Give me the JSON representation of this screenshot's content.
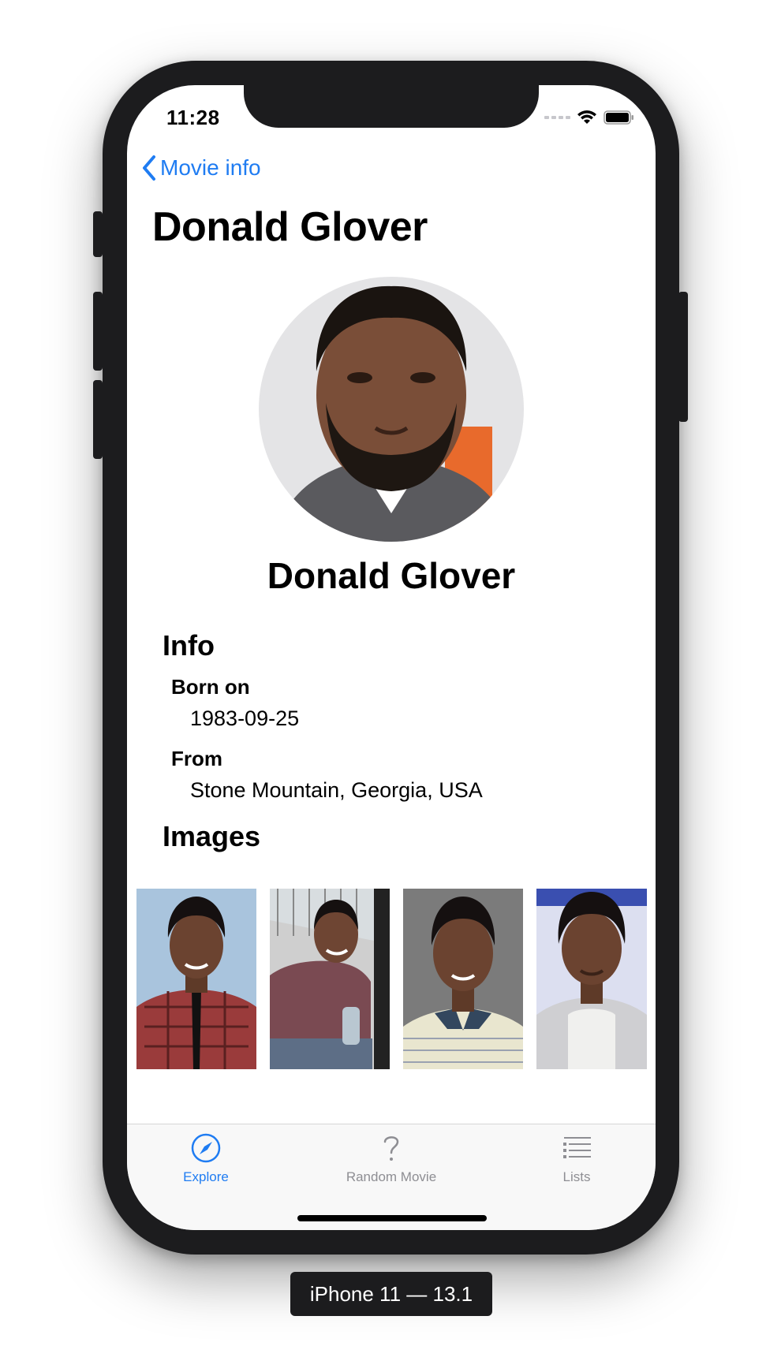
{
  "status_bar": {
    "time": "11:28"
  },
  "nav": {
    "back_label": "Movie info",
    "title": "Donald Glover"
  },
  "person": {
    "name": "Donald Glover"
  },
  "info": {
    "heading": "Info",
    "fields": [
      {
        "label": "Born on",
        "value": "1983-09-25"
      },
      {
        "label": "From",
        "value": "Stone Mountain, Georgia, USA"
      }
    ]
  },
  "images": {
    "heading": "Images",
    "count": 4
  },
  "tabs": [
    {
      "label": "Explore",
      "icon": "compass-icon",
      "selected": true
    },
    {
      "label": "Random Movie",
      "icon": "question-mark-icon",
      "selected": false
    },
    {
      "label": "Lists",
      "icon": "list-icon",
      "selected": false
    }
  ],
  "device_caption": "iPhone 11 — 13.1",
  "colors": {
    "accent": "#1f7cf2",
    "inactive_tab": "#8e8e93",
    "tabbar_bg": "#f8f8f8"
  }
}
